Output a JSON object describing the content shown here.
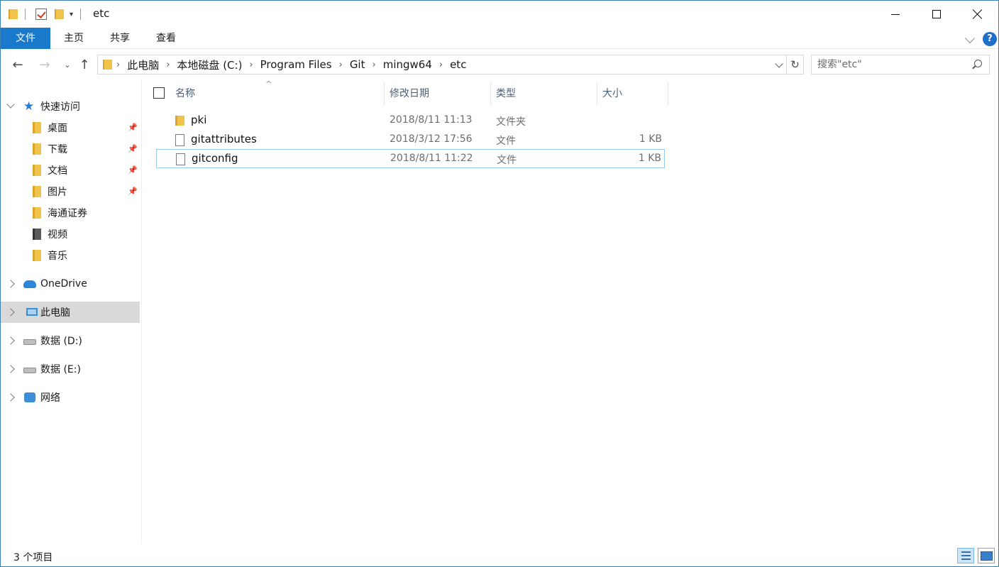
{
  "window": {
    "title": "etc"
  },
  "ribbon": {
    "tabs": [
      {
        "label": "文件"
      },
      {
        "label": "主页"
      },
      {
        "label": "共享"
      },
      {
        "label": "查看"
      }
    ]
  },
  "address_bar": {
    "crumbs": [
      "此电脑",
      "本地磁盘 (C:)",
      "Program Files",
      "Git",
      "mingw64",
      "etc"
    ]
  },
  "search": {
    "placeholder": "搜索\"etc\""
  },
  "sidebar": {
    "items": [
      {
        "label": "快速访问",
        "icon": "star-icon"
      },
      {
        "label": "桌面",
        "icon": "desktop-folder-icon",
        "pinned": true
      },
      {
        "label": "下载",
        "icon": "downloads-folder-icon",
        "pinned": true
      },
      {
        "label": "文档",
        "icon": "documents-folder-icon",
        "pinned": true
      },
      {
        "label": "图片",
        "icon": "pictures-folder-icon",
        "pinned": true
      },
      {
        "label": "海通证券",
        "icon": "folder-icon"
      },
      {
        "label": "视频",
        "icon": "videos-folder-icon"
      },
      {
        "label": "音乐",
        "icon": "music-folder-icon"
      },
      {
        "label": "OneDrive",
        "icon": "onedrive-cloud-icon"
      },
      {
        "label": "此电脑",
        "icon": "this-pc-icon",
        "selected": true
      },
      {
        "label": "数据 (D:)",
        "icon": "drive-icon"
      },
      {
        "label": "数据 (E:)",
        "icon": "drive-icon"
      },
      {
        "label": "网络",
        "icon": "network-icon"
      }
    ]
  },
  "columns": {
    "name": "名称",
    "date": "修改日期",
    "type": "类型",
    "size": "大小"
  },
  "files": [
    {
      "name": "pki",
      "date": "2018/8/11 11:13",
      "type": "文件夹",
      "size": ""
    },
    {
      "name": "gitattributes",
      "date": "2018/3/12 17:56",
      "type": "文件",
      "size": "1 KB"
    },
    {
      "name": "gitconfig",
      "date": "2018/8/11 11:22",
      "type": "文件",
      "size": "1 KB"
    }
  ],
  "status": {
    "item_count": "3 个项目"
  },
  "colors": {
    "accent": "#1979ca",
    "selection": "#d9d9d9",
    "focus_border": "#99c9ef"
  }
}
